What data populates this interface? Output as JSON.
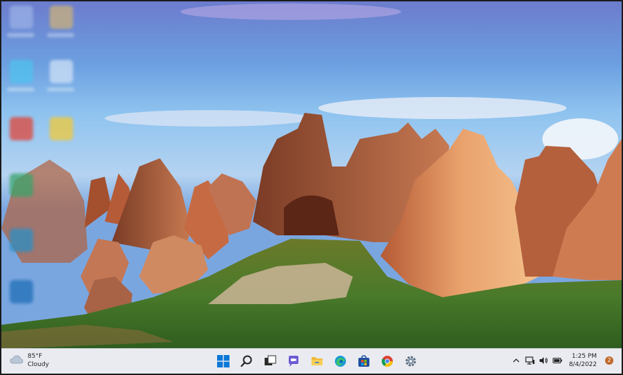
{
  "weather": {
    "temperature": "85°F",
    "condition": "Cloudy",
    "icon": "cloud-icon"
  },
  "taskbar": {
    "apps": [
      {
        "name": "start-button",
        "icon": "windows-logo-icon"
      },
      {
        "name": "search-button",
        "icon": "search-icon"
      },
      {
        "name": "task-view-button",
        "icon": "task-view-icon"
      },
      {
        "name": "teams-chat-button",
        "icon": "teams-chat-icon"
      },
      {
        "name": "file-explorer-button",
        "icon": "folder-icon"
      },
      {
        "name": "edge-button",
        "icon": "edge-icon"
      },
      {
        "name": "store-button",
        "icon": "store-icon"
      },
      {
        "name": "chrome-button",
        "icon": "chrome-icon"
      },
      {
        "name": "settings-button",
        "icon": "gear-icon"
      }
    ]
  },
  "tray": {
    "icons": [
      "chevron-up-icon",
      "network-icon",
      "volume-icon",
      "battery-icon"
    ],
    "time": "1:25 PM",
    "date": "8/4/2022",
    "notification_count": "2"
  },
  "colors": {
    "taskbar_bg": "#e9ebf1",
    "accent": "#0a62d6",
    "notification_badge": "#c0692e"
  }
}
